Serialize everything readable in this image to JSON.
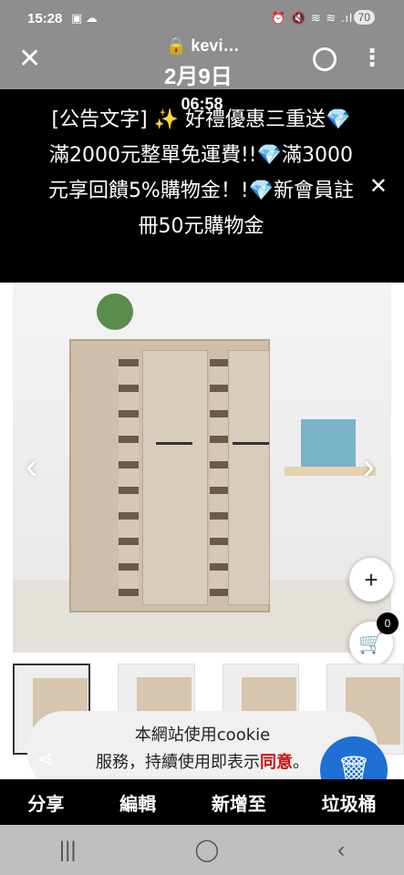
{
  "status_bar": {
    "time": "15:28",
    "left_icons": "▣ ☁",
    "right_icons": "⏰ 🔇 ≋ ≋ .ıl",
    "battery": "70"
  },
  "top_bar": {
    "close_glyph": "✕",
    "url": "🔒 kevi…",
    "date": "2月9日",
    "menu_glyph": "⋮"
  },
  "announcement": {
    "time": "06:58",
    "text": "[公告文字] ✨ 好禮優惠三重送💎滿2000元整單免運費!!💎滿3000元享回饋5%購物金！!💎新會員註冊50元購物金",
    "close_glyph": "✕"
  },
  "image_nav": {
    "prev": "‹",
    "next": "›"
  },
  "fabs": {
    "plus": "+",
    "cart_count": "0",
    "up": "⌃"
  },
  "cookie": {
    "line1": "本網站使用cookie",
    "line2_pre": "服務，持續使用即表示",
    "agree": "同意",
    "line2_post": "。"
  },
  "gallery_actions": {
    "share": "分享",
    "edit": "編輯",
    "add": "新增至",
    "trash": "垃圾桶"
  },
  "nav_bar": {
    "recents": "|||",
    "home": "◯",
    "back": "‹"
  }
}
